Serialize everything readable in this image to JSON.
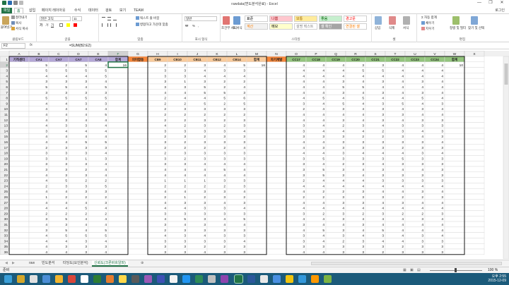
{
  "window": {
    "title": "rawdata(변도분석완료) - Excel",
    "minimize": "—",
    "restore": "❐",
    "close": "✕"
  },
  "tabs": [
    "파일",
    "홈",
    "삽입",
    "페이지 레이아웃",
    "수식",
    "데이터",
    "검토",
    "보기",
    "TEAM"
  ],
  "active_tab": 1,
  "signin": "로그인",
  "ribbon": {
    "clipboard": {
      "group": "클립보드",
      "paste": "붙여넣기",
      "cut": "잘라내기",
      "copy": "복사",
      "format_painter": "서식 복사"
    },
    "font": {
      "group": "글꼴",
      "font_name": "맑은 고딕",
      "font_size": "11",
      "bold": "가",
      "italic": "가",
      "underline": "가"
    },
    "alignment": {
      "group": "맞춤",
      "wrap": "텍스트 줄 바꿈",
      "merge": "병합하고 가운데 맞춤"
    },
    "number": {
      "group": "표시 형식",
      "format": "일반",
      "percent": "%",
      "comma": ",",
      "currency": "₩"
    },
    "styles": {
      "group": "스타일",
      "conditional": "조건부 서식",
      "table": "표 서식",
      "cells": [
        {
          "label": "표준",
          "bg": "#ffffff",
          "fg": "#000000"
        },
        {
          "label": "나쁨",
          "bg": "#ffc7ce",
          "fg": "#9c0006"
        },
        {
          "label": "보통",
          "bg": "#ffeb9c",
          "fg": "#9c6500"
        },
        {
          "label": "좋음",
          "bg": "#c6efce",
          "fg": "#006100"
        },
        {
          "label": "경고문",
          "bg": "#ffffff",
          "fg": "#ff0000"
        },
        {
          "label": "계산",
          "bg": "#f2f2f2",
          "fg": "#fa7d00"
        },
        {
          "label": "메모",
          "bg": "#ffffcc",
          "fg": "#000000"
        },
        {
          "label": "설명 텍스트",
          "bg": "#ffffff",
          "fg": "#7f7f7f"
        },
        {
          "label": "셀 확인",
          "bg": "#a5a5a5",
          "fg": "#ffffff"
        },
        {
          "label": "연결된 셀",
          "bg": "#ffffff",
          "fg": "#fa7d00"
        }
      ]
    },
    "cells": {
      "group": "셀",
      "insert": "삽입",
      "delete": "삭제",
      "format": "서식"
    },
    "editing": {
      "group": "편집",
      "autosum": "자동 합계",
      "fill": "채우기",
      "clear": "지우기",
      "sort": "정렬 및 필터",
      "find": "찾기 및 선택"
    }
  },
  "formula_bar": {
    "name_box": "F2",
    "fx": "fx",
    "formula": "=SUM(B2:E2)"
  },
  "grid": {
    "columns": [
      "A",
      "B",
      "C",
      "D",
      "E",
      "F",
      "G",
      "H",
      "I",
      "J",
      "K",
      "L",
      "M",
      "N",
      "O",
      "P",
      "Q",
      "R",
      "S",
      "T",
      "U",
      "V",
      "W",
      "X"
    ],
    "headers": [
      "기적센터",
      "CA1",
      "CA7",
      "CA7",
      "CA8",
      "합계",
      "의미합동",
      "CB9",
      "CB10",
      "CB11",
      "CB12",
      "CB14",
      "합계",
      "자기계발",
      "CC17",
      "CC18",
      "CC19",
      "CC20",
      "CC21",
      "CC22",
      "CC23",
      "CC24",
      "합계",
      ""
    ],
    "header_colors": {
      "A": "#b4a7d6",
      "B": "#b4a7d6",
      "C": "#b4a7d6",
      "D": "#b4a7d6",
      "E": "#b4a7d6",
      "F": "#b4a7d6",
      "G": "#f6863a",
      "H": "#f9cb9c",
      "I": "#f9cb9c",
      "J": "#f9cb9c",
      "K": "#f9cb9c",
      "L": "#f9cb9c",
      "M": "#f9cb9c",
      "N": "#f6863a",
      "O": "#93c47d",
      "P": "#93c47d",
      "Q": "#93c47d",
      "R": "#93c47d",
      "S": "#93c47d",
      "T": "#93c47d",
      "U": "#93c47d",
      "V": "#93c47d",
      "W": "#93c47d",
      "X": "#ffffff"
    },
    "row_numbers_start": 1,
    "rows": [
      [
        "",
        5,
        2,
        5,
        4,
        16,
        "",
        2,
        2,
        3,
        4,
        5,
        16,
        "",
        4,
        4,
        4,
        3,
        3,
        4,
        4,
        4,
        10,
        ""
      ],
      [
        "",
        5,
        5,
        5,
        5,
        "",
        "",
        3,
        3,
        4,
        3,
        3,
        "",
        "",
        4,
        4,
        4,
        5,
        5,
        4,
        4,
        4,
        "",
        ""
      ],
      [
        "",
        4,
        4,
        4,
        5,
        "",
        "",
        3,
        3,
        4,
        4,
        4,
        "",
        "",
        4,
        4,
        4,
        4,
        4,
        4,
        4,
        4,
        "",
        ""
      ],
      [
        "",
        3,
        3,
        3,
        4,
        "",
        "",
        3,
        1,
        3,
        2,
        2,
        "",
        "",
        4,
        4,
        3,
        4,
        3,
        4,
        3,
        4,
        "",
        ""
      ],
      [
        "",
        5,
        5,
        4,
        5,
        "",
        "",
        3,
        3,
        5,
        2,
        4,
        "",
        "",
        4,
        4,
        5,
        5,
        4,
        4,
        4,
        4,
        "",
        ""
      ],
      [
        "",
        3,
        3,
        3,
        3,
        "",
        "",
        4,
        4,
        5,
        5,
        3,
        "",
        "",
        4,
        4,
        3,
        4,
        3,
        4,
        3,
        4,
        "",
        ""
      ],
      [
        "",
        5,
        5,
        5,
        5,
        "",
        "",
        2,
        4,
        4,
        5,
        6,
        "",
        "",
        4,
        5,
        4,
        5,
        4,
        4,
        5,
        4,
        "",
        ""
      ],
      [
        "",
        4,
        4,
        3,
        3,
        "",
        "",
        2,
        2,
        5,
        2,
        5,
        "",
        "",
        3,
        4,
        5,
        4,
        3,
        5,
        4,
        3,
        "",
        ""
      ],
      [
        "",
        4,
        4,
        4,
        4,
        "",
        "",
        2,
        3,
        3,
        3,
        3,
        "",
        "",
        2,
        4,
        3,
        4,
        3,
        4,
        3,
        4,
        "",
        ""
      ],
      [
        "",
        4,
        4,
        4,
        5,
        "",
        "",
        2,
        2,
        2,
        2,
        2,
        "",
        "",
        4,
        4,
        4,
        4,
        3,
        3,
        4,
        4,
        "",
        ""
      ],
      [
        "",
        4,
        3,
        4,
        4,
        "",
        "",
        2,
        2,
        3,
        2,
        3,
        "",
        "",
        4,
        4,
        3,
        4,
        3,
        4,
        3,
        3,
        "",
        ""
      ],
      [
        "",
        4,
        3,
        3,
        4,
        "",
        "",
        4,
        2,
        3,
        2,
        3,
        "",
        "",
        3,
        4,
        2,
        3,
        4,
        3,
        3,
        3,
        "",
        ""
      ],
      [
        "",
        3,
        4,
        4,
        4,
        "",
        "",
        3,
        3,
        3,
        3,
        4,
        "",
        "",
        3,
        4,
        4,
        4,
        2,
        3,
        4,
        3,
        "",
        ""
      ],
      [
        "",
        4,
        4,
        4,
        4,
        "",
        "",
        2,
        3,
        2,
        3,
        3,
        "",
        "",
        3,
        3,
        3,
        2,
        2,
        3,
        4,
        3,
        "",
        ""
      ],
      [
        "",
        4,
        4,
        5,
        5,
        "",
        "",
        3,
        2,
        3,
        3,
        3,
        "",
        "",
        4,
        4,
        3,
        3,
        3,
        3,
        3,
        4,
        "",
        ""
      ],
      [
        "",
        2,
        3,
        3,
        3,
        "",
        "",
        2,
        2,
        2,
        2,
        4,
        "",
        "",
        4,
        3,
        3,
        3,
        3,
        2,
        3,
        3,
        "",
        ""
      ],
      [
        "",
        3,
        3,
        3,
        4,
        "",
        "",
        2,
        3,
        3,
        3,
        3,
        "",
        "",
        4,
        4,
        3,
        4,
        4,
        4,
        3,
        4,
        "",
        ""
      ],
      [
        "",
        3,
        3,
        1,
        3,
        "",
        "",
        3,
        2,
        3,
        3,
        3,
        "",
        "",
        3,
        5,
        3,
        3,
        3,
        5,
        3,
        3,
        "",
        ""
      ],
      [
        "",
        3,
        3,
        3,
        4,
        "",
        "",
        3,
        3,
        4,
        4,
        4,
        "",
        "",
        3,
        4,
        2,
        3,
        4,
        3,
        3,
        3,
        "",
        ""
      ],
      [
        "",
        3,
        3,
        2,
        4,
        "",
        "",
        4,
        4,
        4,
        5,
        4,
        "",
        "",
        3,
        5,
        3,
        4,
        3,
        4,
        4,
        3,
        "",
        ""
      ],
      [
        "",
        4,
        3,
        3,
        4,
        "",
        "",
        4,
        4,
        4,
        4,
        4,
        "",
        "",
        3,
        5,
        3,
        4,
        3,
        3,
        3,
        3,
        "",
        ""
      ],
      [
        "",
        4,
        5,
        2,
        2,
        "",
        "",
        1,
        1,
        1,
        3,
        3,
        "",
        "",
        2,
        4,
        4,
        4,
        3,
        3,
        3,
        3,
        "",
        ""
      ],
      [
        "",
        2,
        3,
        3,
        5,
        "",
        "",
        2,
        2,
        2,
        2,
        3,
        "",
        "",
        4,
        4,
        4,
        4,
        4,
        4,
        4,
        4,
        "",
        ""
      ],
      [
        "",
        4,
        4,
        3,
        3,
        "",
        "",
        4,
        4,
        3,
        3,
        4,
        "",
        "",
        4,
        2,
        2,
        3,
        4,
        4,
        3,
        4,
        "",
        ""
      ],
      [
        "",
        1,
        2,
        2,
        2,
        "",
        "",
        2,
        1,
        2,
        3,
        2,
        "",
        "",
        2,
        2,
        3,
        3,
        3,
        2,
        2,
        3,
        "",
        ""
      ],
      [
        "",
        4,
        4,
        4,
        3,
        "",
        "",
        4,
        3,
        3,
        4,
        3,
        "",
        "",
        4,
        4,
        3,
        3,
        4,
        3,
        4,
        4,
        "",
        ""
      ],
      [
        "",
        4,
        4,
        5,
        4,
        "",
        "",
        4,
        4,
        3,
        3,
        4,
        "",
        "",
        4,
        4,
        4,
        4,
        4,
        4,
        4,
        4,
        "",
        ""
      ],
      [
        "",
        2,
        2,
        2,
        2,
        "",
        "",
        3,
        3,
        3,
        3,
        3,
        "",
        "",
        3,
        2,
        3,
        2,
        3,
        2,
        2,
        3,
        "",
        ""
      ],
      [
        "",
        3,
        5,
        4,
        4,
        "",
        "",
        4,
        5,
        3,
        4,
        5,
        "",
        "",
        4,
        4,
        3,
        4,
        4,
        4,
        3,
        4,
        "",
        ""
      ],
      [
        "",
        4,
        3,
        4,
        4,
        "",
        "",
        3,
        4,
        3,
        4,
        4,
        "",
        "",
        3,
        4,
        4,
        3,
        4,
        4,
        4,
        4,
        "",
        ""
      ],
      [
        "",
        3,
        5,
        4,
        5,
        "",
        "",
        2,
        3,
        3,
        3,
        3,
        "",
        "",
        4,
        5,
        3,
        4,
        5,
        4,
        4,
        4,
        "",
        ""
      ],
      [
        "",
        4,
        5,
        5,
        5,
        "",
        "",
        4,
        3,
        4,
        3,
        3,
        "",
        "",
        3,
        4,
        3,
        4,
        3,
        4,
        3,
        4,
        "",
        ""
      ],
      [
        "",
        4,
        4,
        3,
        4,
        "",
        "",
        3,
        3,
        3,
        3,
        4,
        "",
        "",
        3,
        4,
        2,
        3,
        4,
        4,
        3,
        3,
        "",
        ""
      ],
      [
        "",
        4,
        3,
        3,
        3,
        "",
        "",
        3,
        3,
        2,
        2,
        3,
        "",
        "",
        3,
        3,
        3,
        3,
        3,
        2,
        3,
        3,
        "",
        ""
      ],
      [
        "",
        4,
        4,
        3,
        4,
        "",
        "",
        3,
        3,
        4,
        3,
        3,
        "",
        "",
        4,
        4,
        3,
        3,
        2,
        3,
        3,
        3,
        "",
        ""
      ]
    ]
  },
  "sheets": [
    "raw",
    "빈도분석",
    "타당도(요인분석)",
    "신뢰도(크론바흐알파)"
  ],
  "active_sheet": 3,
  "status": {
    "ready": "준비",
    "zoom": "100 %"
  },
  "clock": {
    "time": "오후 2:55",
    "date": "2015-12-09"
  }
}
